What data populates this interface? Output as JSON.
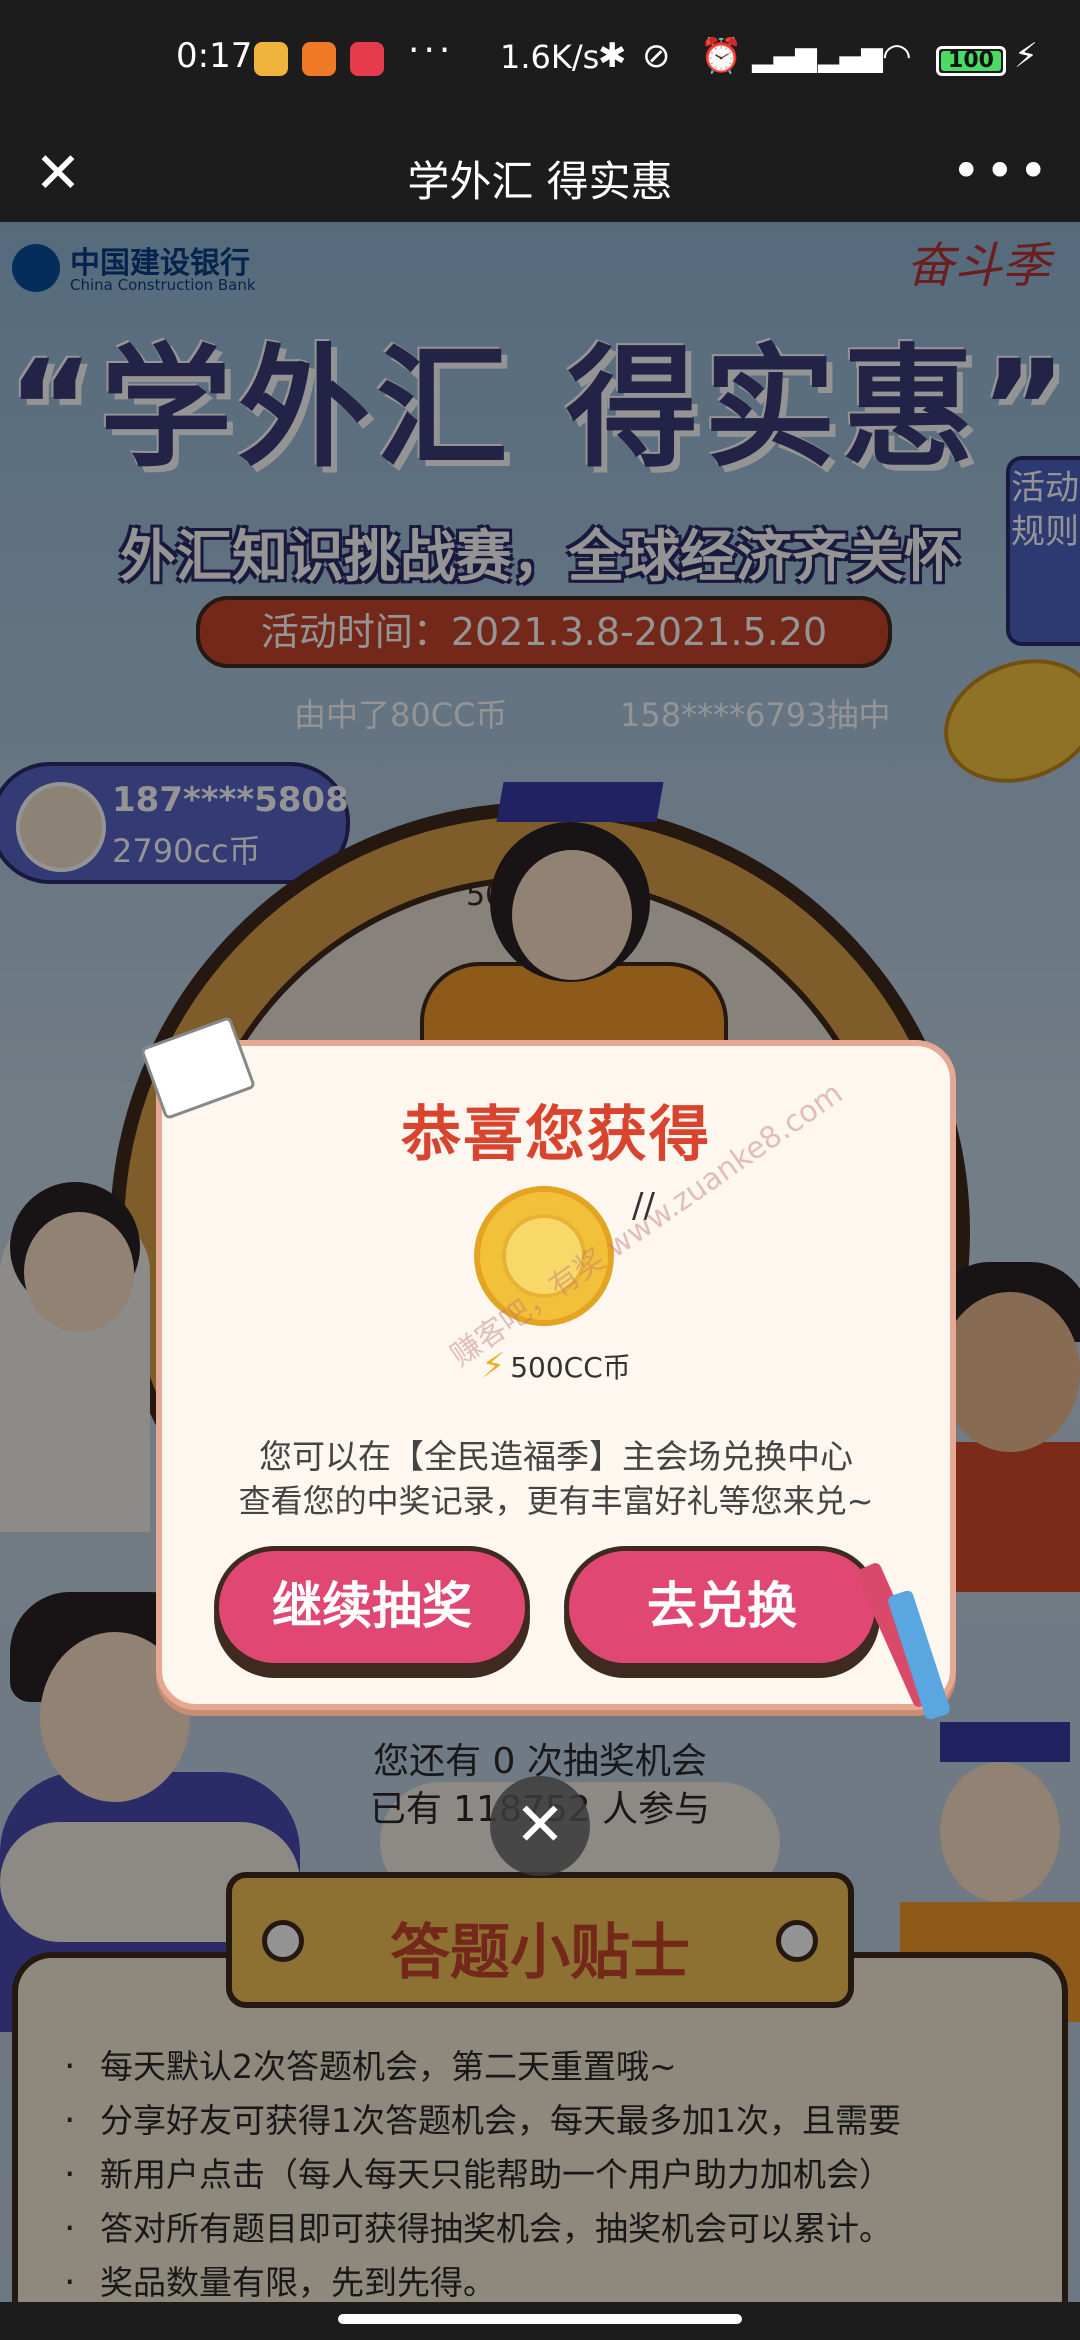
{
  "status_bar": {
    "time": "0:17",
    "net_speed": "1.6K/s",
    "battery": "100",
    "icons": [
      "notification-icon",
      "app-icon",
      "app-icon",
      "bluetooth-icon",
      "mute-icon",
      "alarm-icon",
      "signal-icon",
      "signal-icon",
      "wifi-icon",
      "charging-icon"
    ]
  },
  "nav": {
    "title": "学外汇 得实惠",
    "close": "✕",
    "more": "•••"
  },
  "page": {
    "bank_name_cn": "中国建设银行",
    "bank_name_en": "China Construction Bank",
    "headline": "“学外汇 得实惠”",
    "subhead": "外汇知识挑战赛，全球经济齐关怀",
    "date_range": "活动时间：2021.3.8-2021.5.20",
    "rules_tab": "活动规则",
    "ticker_left": "由中了80CC币",
    "ticker_right": "158****6793抽中",
    "winner": {
      "phone": "187****5808",
      "coins": "2790cc币"
    },
    "wheel_label": "500",
    "chances": "您还有  0  次抽奖机会",
    "participants": "已有 118752 人参与"
  },
  "tips": {
    "title": "答题小贴士",
    "items": [
      "每天默认2次答题机会，第二天重置哦~",
      "分享好友可获得1次答题机会，每天最多加1次，且需要",
      "新用户点击（每人每天只能帮助一个用户助力加机会）",
      "答对所有题目即可获得抽奖机会，抽奖机会可以累计。",
      "奖品数量有限，先到先得。"
    ]
  },
  "dialog": {
    "title": "恭喜您获得",
    "prize": "500CC币",
    "line1": "您可以在【全民造福季】主会场兑换中心",
    "line2": "查看您的中奖记录，更有丰富好礼等您来兑~",
    "continue_label": "继续抽奖",
    "redeem_label": "去兑换",
    "close": "✕"
  },
  "watermark": "赚客吧，有奖 www.zuanke8.com",
  "colors": {
    "accent": "#e04873",
    "title_red": "#d9442e",
    "dark_outline": "#3e2a1e",
    "rules_blue": "#4f63c3"
  }
}
